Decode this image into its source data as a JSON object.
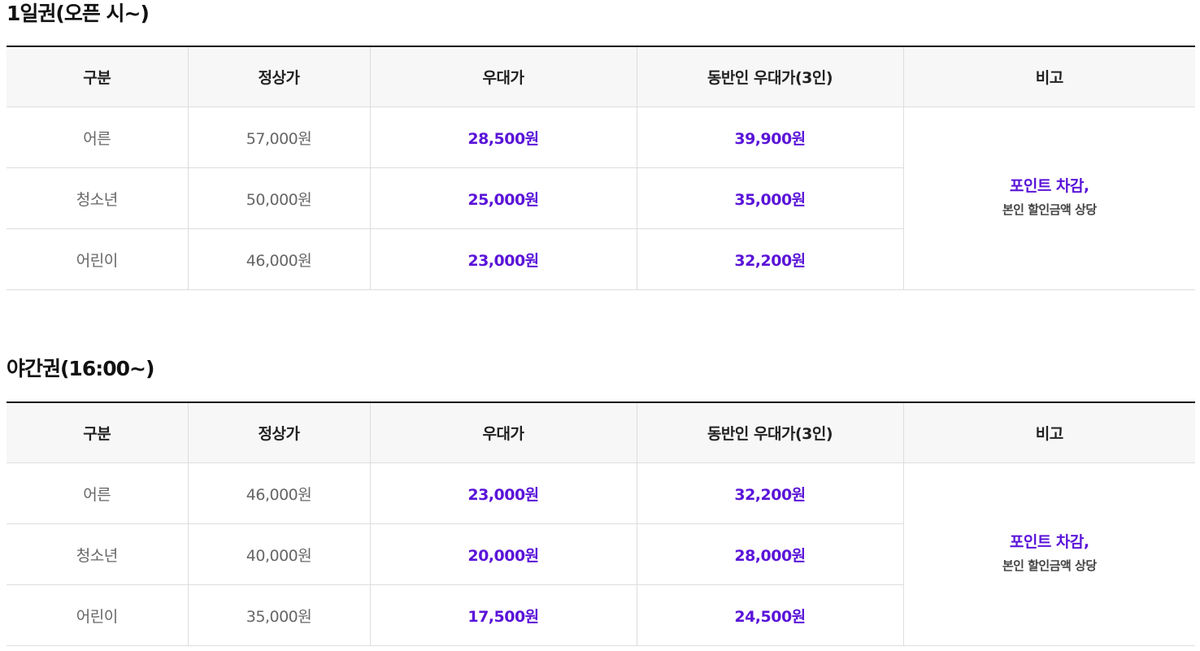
{
  "headers": [
    "구분",
    "정상가",
    "우대가",
    "동반인 우대가(3인)",
    "비고"
  ],
  "sections": [
    {
      "title": "1일권(오픈 시~)",
      "rows": [
        {
          "category": "어른",
          "regular": "57,000원",
          "discount": "28,500원",
          "companion": "39,900원"
        },
        {
          "category": "청소년",
          "regular": "50,000원",
          "discount": "25,000원",
          "companion": "35,000원"
        },
        {
          "category": "어린이",
          "regular": "46,000원",
          "discount": "23,000원",
          "companion": "32,200원"
        }
      ],
      "note_main": "포인트 차감,",
      "note_sub": "본인 할인금액 상당"
    },
    {
      "title": "야간권(16:00~)",
      "rows": [
        {
          "category": "어른",
          "regular": "46,000원",
          "discount": "23,000원",
          "companion": "32,200원"
        },
        {
          "category": "청소년",
          "regular": "40,000원",
          "discount": "20,000원",
          "companion": "28,000원"
        },
        {
          "category": "어린이",
          "regular": "35,000원",
          "discount": "17,500원",
          "companion": "24,500원"
        }
      ],
      "note_main": "포인트 차감,",
      "note_sub": "본인 할인금액 상당"
    }
  ],
  "colors": {
    "accent": "#5a14d8",
    "header_bg": "#f7f7f7",
    "border": "#dddddd",
    "top_rule": "#111111"
  }
}
